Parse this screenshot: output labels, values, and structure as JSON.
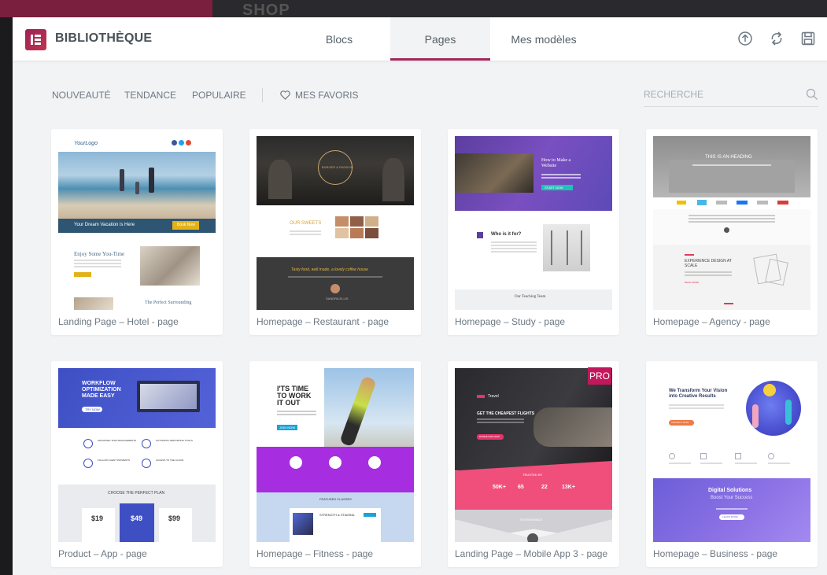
{
  "background": {
    "text": "SHOP"
  },
  "header": {
    "title": "BIBLIOTHÈQUE",
    "tabs": [
      {
        "label": "Blocs"
      },
      {
        "label": "Pages",
        "active": true
      },
      {
        "label": "Mes modèles"
      }
    ],
    "icons": [
      "upload-icon",
      "sync-icon",
      "save-icon"
    ],
    "accent": "#a4285a"
  },
  "filters": {
    "items": [
      {
        "label": "NOUVEAUTÉ"
      },
      {
        "label": "TENDANCE"
      },
      {
        "label": "POPULAIRE"
      }
    ],
    "favorites_label": "MES FAVORIS",
    "search_placeholder": "RECHERCHE"
  },
  "templates": [
    {
      "caption": "Landing Page – Hotel - page",
      "preview": {
        "logo": "YourLogo",
        "banner": "Your Dream Vacation is Here",
        "cta": "Book Now",
        "heading1": "Enjoy Some You-Time",
        "heading2": "The Perfect Surrounding"
      }
    },
    {
      "caption": "Homepage – Restaurant - page",
      "preview": {
        "badge": "BURGER & PASSION",
        "heading": "OUR SWEETS",
        "quote": "Tasty food, well made, a lovely coffee house",
        "author": "SANDRA ELLIS"
      }
    },
    {
      "caption": "Homepage – Study - page",
      "preview": {
        "heading": "How to Make a Website",
        "cta": "START NOW",
        "subheading": "Who is it for?",
        "footer": "Our Teaching Team"
      }
    },
    {
      "caption": "Homepage – Agency - page",
      "preview": {
        "heading": "THIS IS AN HEADING",
        "subheading": "EXPERIENCE DESIGN AT SCALE",
        "link": "READ MORE"
      }
    },
    {
      "caption": "Product – App - page",
      "preview": {
        "heading": "WORKFLOW OPTIMIZATION MADE EASY",
        "cta": "TRY NOW",
        "features": [
          "ADVANCED TASK MANAGEMENTS",
          "AUTOMATIC REPORTING TOOLS",
          "FOLLOW CLIENT PAYMENTS",
          "ACCESS TO THE CLOUD"
        ],
        "plan_title": "CHOOSE THE PERFECT PLAN",
        "prices": [
          "$19",
          "$49",
          "$99"
        ]
      }
    },
    {
      "caption": "Homepage – Fitness - page",
      "preview": {
        "heading": "I'TS TIME TO WORK IT OUT",
        "cta": "JOIN NOW",
        "section": "FEATURED CLASSES",
        "class": "STRENGTH & STAMINA"
      }
    },
    {
      "caption": "Landing Page – Mobile App 3 - page",
      "pro": "PRO",
      "preview": {
        "brand": "Travel",
        "heading": "GET THE CHEAPEST FLIGHTS",
        "cta": "DOWNLOAD NOW",
        "trusted": "TRUSTED BY",
        "stats": [
          "50K+",
          "65",
          "22",
          "13K+"
        ],
        "testimonials": "TESTIMONIALS"
      }
    },
    {
      "caption": "Homepage – Business - page",
      "preview": {
        "heading": "We Transform Your Vision into Creative Results",
        "cta": "CONTACT NOW",
        "banner_title": "Digital Solutions",
        "banner_sub": "Boost Your Success",
        "banner_cta": "LEARN MORE"
      }
    }
  ]
}
